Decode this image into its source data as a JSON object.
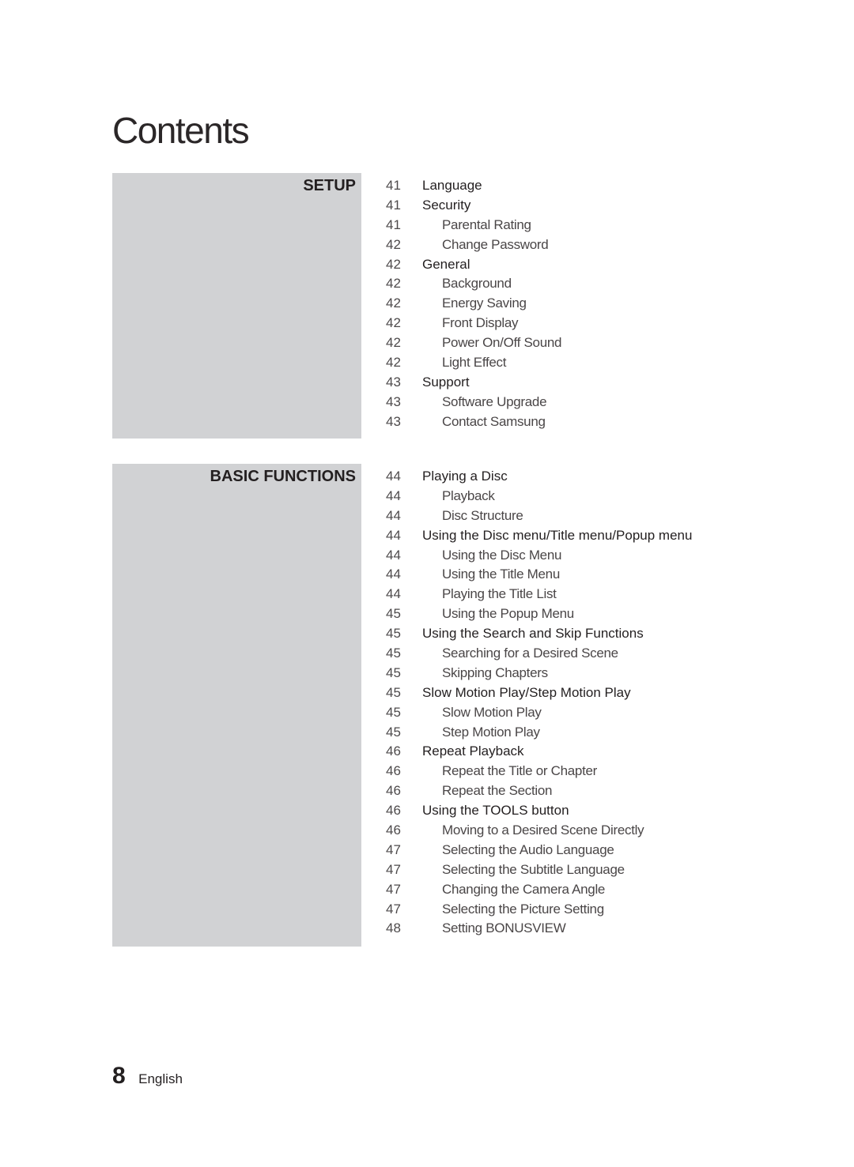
{
  "page_title": "Contents",
  "sections": [
    {
      "label": "SETUP",
      "entries": [
        {
          "page": "41",
          "title": "Language",
          "level": 1
        },
        {
          "page": "41",
          "title": "Security",
          "level": 1
        },
        {
          "page": "41",
          "title": "Parental Rating",
          "level": 2
        },
        {
          "page": "42",
          "title": "Change Password",
          "level": 2
        },
        {
          "page": "42",
          "title": "General",
          "level": 1
        },
        {
          "page": "42",
          "title": "Background",
          "level": 2
        },
        {
          "page": "42",
          "title": "Energy Saving",
          "level": 2
        },
        {
          "page": "42",
          "title": "Front Display",
          "level": 2
        },
        {
          "page": "42",
          "title": "Power On/Off Sound",
          "level": 2
        },
        {
          "page": "42",
          "title": "Light Effect",
          "level": 2
        },
        {
          "page": "43",
          "title": "Support",
          "level": 1
        },
        {
          "page": "43",
          "title": "Software Upgrade",
          "level": 2
        },
        {
          "page": "43",
          "title": "Contact Samsung",
          "level": 2
        }
      ]
    },
    {
      "label": "BASIC FUNCTIONS",
      "entries": [
        {
          "page": "44",
          "title": "Playing a Disc",
          "level": 1
        },
        {
          "page": "44",
          "title": "Playback",
          "level": 2
        },
        {
          "page": "44",
          "title": "Disc Structure",
          "level": 2
        },
        {
          "page": "44",
          "title": "Using the Disc menu/Title menu/Popup menu",
          "level": 1
        },
        {
          "page": "44",
          "title": "Using the Disc Menu",
          "level": 2
        },
        {
          "page": "44",
          "title": "Using the Title Menu",
          "level": 2
        },
        {
          "page": "44",
          "title": "Playing the Title List",
          "level": 2
        },
        {
          "page": "45",
          "title": "Using the Popup Menu",
          "level": 2
        },
        {
          "page": "45",
          "title": "Using the Search and Skip Functions",
          "level": 1
        },
        {
          "page": "45",
          "title": "Searching for a Desired Scene",
          "level": 2
        },
        {
          "page": "45",
          "title": "Skipping Chapters",
          "level": 2
        },
        {
          "page": "45",
          "title": "Slow Motion Play/Step Motion Play",
          "level": 1
        },
        {
          "page": "45",
          "title": "Slow Motion Play",
          "level": 2
        },
        {
          "page": "45",
          "title": "Step Motion Play",
          "level": 2
        },
        {
          "page": "46",
          "title": "Repeat Playback",
          "level": 1
        },
        {
          "page": "46",
          "title": "Repeat the Title or Chapter",
          "level": 2
        },
        {
          "page": "46",
          "title": "Repeat the Section",
          "level": 2
        },
        {
          "page": "46",
          "title": "Using the TOOLS button",
          "level": 1
        },
        {
          "page": "46",
          "title": "Moving to a Desired Scene Directly",
          "level": 2
        },
        {
          "page": "47",
          "title": "Selecting the Audio Language",
          "level": 2
        },
        {
          "page": "47",
          "title": "Selecting the Subtitle Language",
          "level": 2
        },
        {
          "page": "47",
          "title": "Changing the Camera Angle",
          "level": 2
        },
        {
          "page": "47",
          "title": "Selecting the Picture Setting",
          "level": 2
        },
        {
          "page": "48",
          "title": "Setting BONUSVIEW",
          "level": 2
        }
      ]
    }
  ],
  "footer": {
    "page_number": "8",
    "language": "English"
  },
  "colors": {
    "section_box": "#d1d2d4",
    "text": "#231f20"
  }
}
